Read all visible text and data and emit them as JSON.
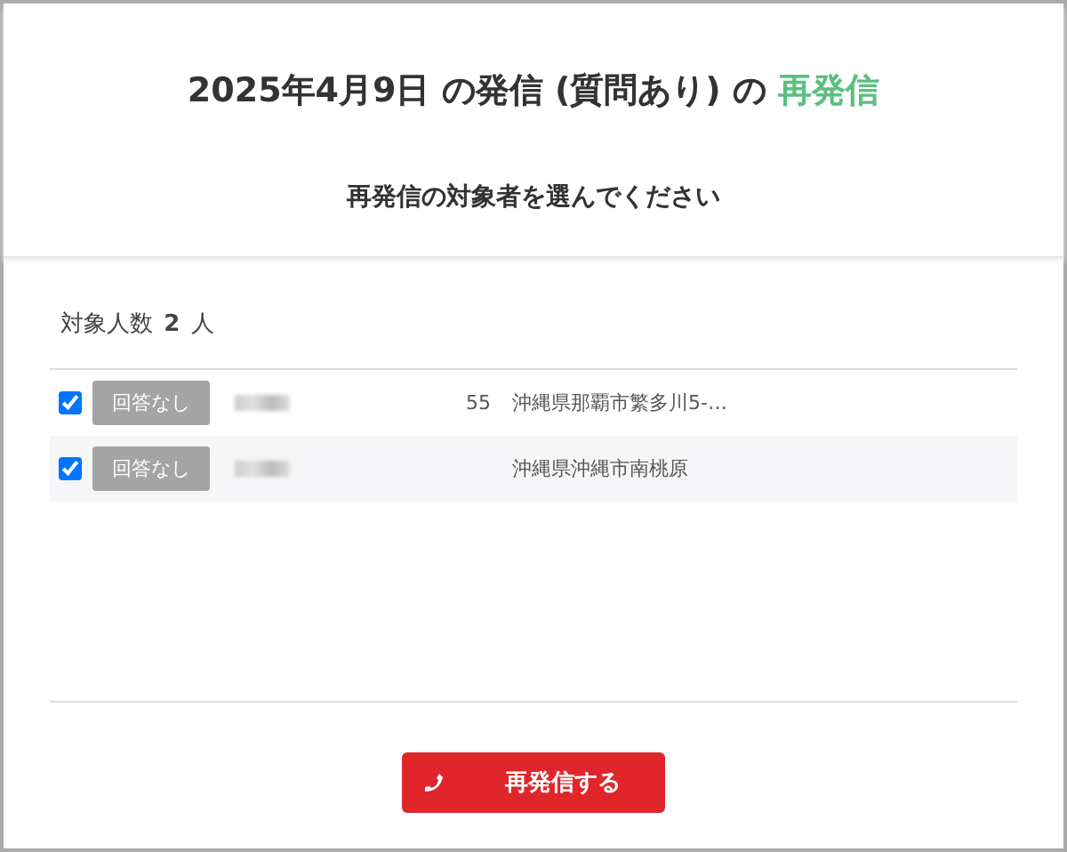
{
  "title": {
    "prefix": "2025年4月9日 の発信 (質問あり) の",
    "highlight": "再発信"
  },
  "subtitle": "再発信の対象者を選んでください",
  "count": {
    "label": "対象人数",
    "value": "2",
    "unit": "人"
  },
  "rows": [
    {
      "checked": true,
      "status": "回答なし",
      "age": "55",
      "address": "沖縄県那覇市繁多川5-…"
    },
    {
      "checked": true,
      "status": "回答なし",
      "address": "沖縄県沖縄市南桃原"
    }
  ],
  "button": "再発信する"
}
